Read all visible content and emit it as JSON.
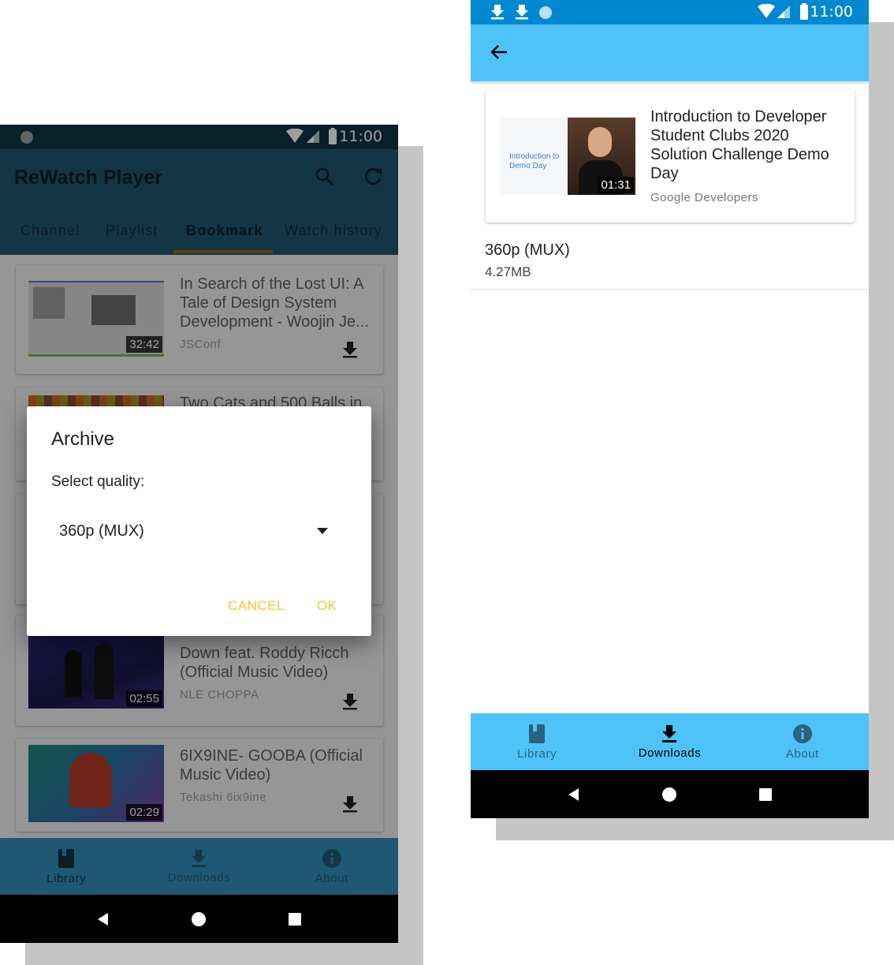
{
  "left": {
    "status": {
      "time": "11:00"
    },
    "app_title": "ReWatch Player",
    "tabs": [
      {
        "label": "Channel"
      },
      {
        "label": "Playlist"
      },
      {
        "label": "Bookmark",
        "selected": true
      },
      {
        "label": "Watch history"
      }
    ],
    "videos": [
      {
        "title": "In Search of the Lost UI: A Tale of Design System Development - Woojin Je...",
        "channel": "JSConf",
        "duration": "32:42"
      },
      {
        "title": "Two Cats and 500 Balls in",
        "channel": "",
        "duration": ""
      },
      {
        "title": "NLE Choppa - Walk Em Down feat. Roddy Ricch (Official Music Video)",
        "title_visible": "Down feat. Roddy Ricch (Official Music Video)",
        "channel": "NLE CHOPPA",
        "duration": "02:55"
      },
      {
        "title": "6IX9INE- GOOBA (Official Music Video)",
        "channel": "Tekashi 6ix9ine",
        "duration": "02:29"
      }
    ],
    "dialog": {
      "title": "Archive",
      "label": "Select quality:",
      "selected": "360p (MUX)",
      "cancel": "CANCEL",
      "ok": "OK"
    },
    "bottom_nav": [
      {
        "label": "Library",
        "icon": "book-icon",
        "active": true
      },
      {
        "label": "Downloads",
        "icon": "download-icon",
        "active": false
      },
      {
        "label": "About",
        "icon": "info-icon",
        "active": false
      }
    ]
  },
  "right": {
    "status": {
      "time": "11:00"
    },
    "video": {
      "title": "Introduction to Developer Student Clubs 2020 Solution Challenge Demo Day",
      "channel": "Google Developers",
      "duration": "01:31",
      "thumb_text": "Introduction to Demo Day"
    },
    "file": {
      "quality": "360p (MUX)",
      "size": "4.27MB"
    },
    "bottom_nav": [
      {
        "label": "Library",
        "icon": "book-icon",
        "active": false
      },
      {
        "label": "Downloads",
        "icon": "download-icon",
        "active": true
      },
      {
        "label": "About",
        "icon": "info-icon",
        "active": false
      }
    ]
  },
  "colors": {
    "primary_light": "#4fc3f7",
    "primary_dark_left": "#1f5872",
    "status_right": "#0288d1",
    "accent": "#fbc02d"
  }
}
